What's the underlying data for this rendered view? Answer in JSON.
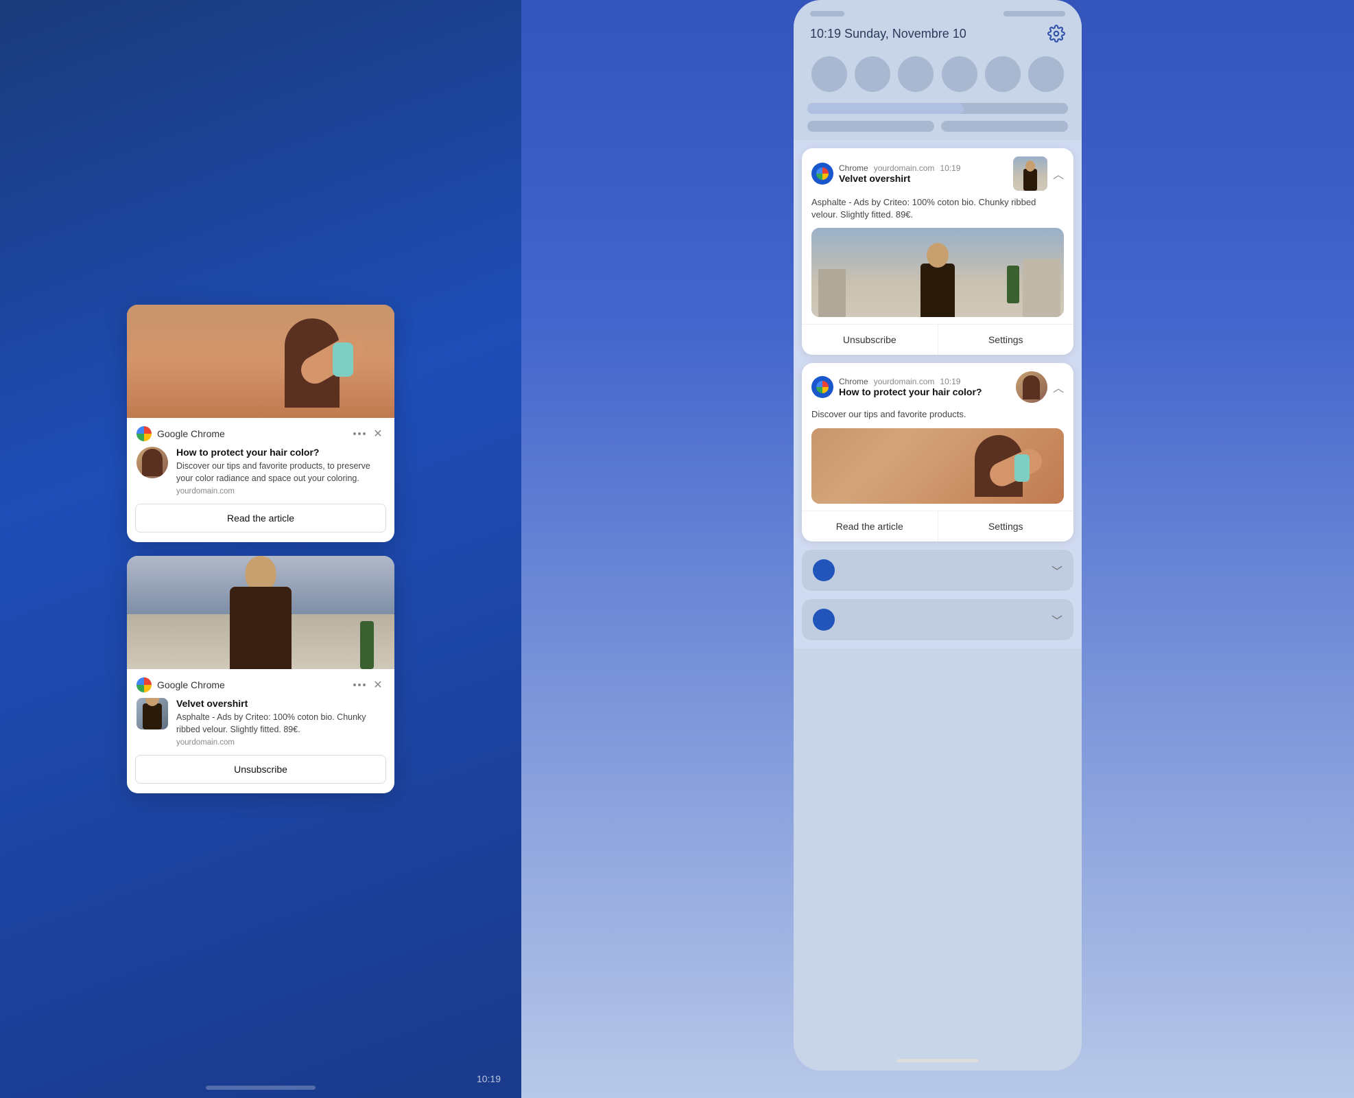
{
  "left": {
    "time_bottom": "10:19",
    "card1": {
      "chrome_label": "Google Chrome",
      "title": "How to protect your hair color?",
      "description": "Discover our tips and favorite products, to preserve your color radiance and space out your coloring.",
      "domain": "yourdomain.com",
      "action_label": "Read the article"
    },
    "card2": {
      "chrome_label": "Google Chrome",
      "title": "Velvet overshirt",
      "description": "Asphalte - Ads by Criteo: 100% coton bio. Chunky ribbed velour. Slightly fitted. 89€.",
      "domain": "yourdomain.com",
      "action_label": "Unsubscribe"
    }
  },
  "right": {
    "status_bar": {
      "left_pill": "",
      "right_pill": ""
    },
    "datetime": "10:19  Sunday, Novembre 10",
    "notif1": {
      "source": "Chrome",
      "domain": "yourdomain.com",
      "time": "10:19",
      "title": "Velvet overshirt",
      "description": "Asphalte - Ads by Criteo: 100% coton bio. Chunky ribbed velour. Slightly fitted. 89€.",
      "action1": "Unsubscribe",
      "action2": "Settings"
    },
    "notif2": {
      "source": "Chrome",
      "domain": "yourdomain.com",
      "time": "10:19",
      "title": "How to protect your hair color?",
      "description": "Discover our tips and favorite products.",
      "action1": "Read the article",
      "action2": "Settings"
    },
    "gear_icon_label": "⚙",
    "chevron_up": "︿",
    "chevron_down": "﹀"
  }
}
